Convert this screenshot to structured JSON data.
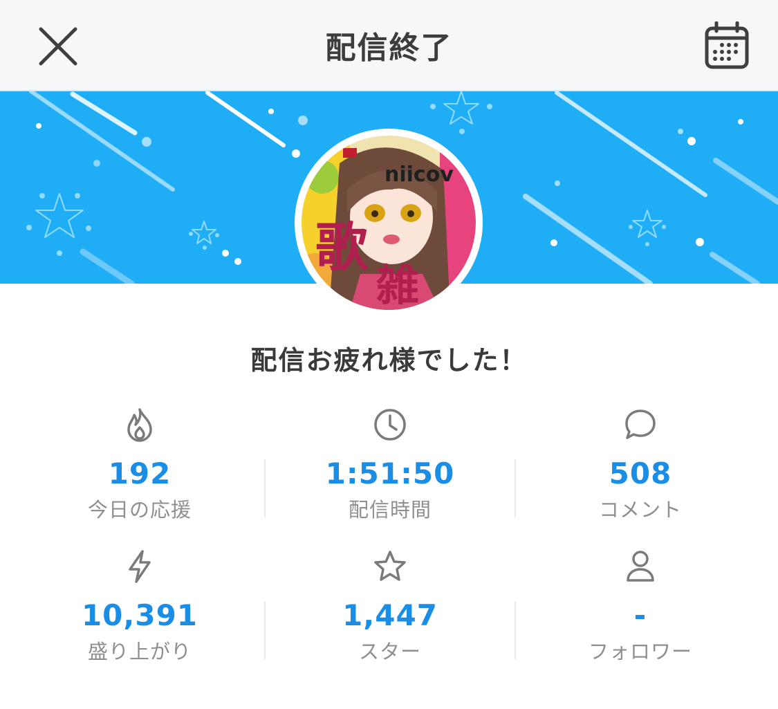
{
  "header": {
    "title": "配信終了",
    "close_icon": "close-icon",
    "calendar_icon": "calendar-icon"
  },
  "banner": {
    "background_color": "#1fadf6",
    "avatar": {
      "logo_text": "niicov",
      "big_text_1": "歌",
      "big_text_2": "雑"
    }
  },
  "message": "配信お疲れ様でした！",
  "stats": [
    {
      "icon": "flame-icon",
      "value": "192",
      "label": "今日の応援"
    },
    {
      "icon": "clock-icon",
      "value": "1:51:50",
      "label": "配信時間"
    },
    {
      "icon": "comment-icon",
      "value": "508",
      "label": "コメント"
    },
    {
      "icon": "lightning-icon",
      "value": "10,391",
      "label": "盛り上がり"
    },
    {
      "icon": "star-icon",
      "value": "1,447",
      "label": "スター"
    },
    {
      "icon": "person-icon",
      "value": "-",
      "label": "フォロワー"
    }
  ],
  "colors": {
    "accent": "#1a8ee6",
    "label": "#8f8f8f",
    "icon": "#7a7a7a"
  }
}
